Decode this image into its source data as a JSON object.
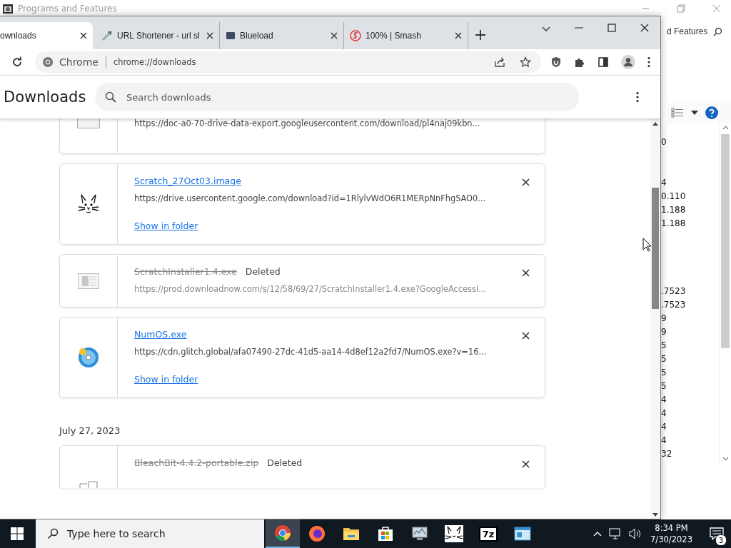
{
  "background_window": {
    "title": "Programs and Features",
    "search": {
      "value": "d Features"
    },
    "version_column": [
      [
        "0"
      ],
      [
        "4",
        "0.110",
        "1.188",
        "1.188"
      ],
      [
        ".7523",
        ".7523",
        "9",
        "9",
        "5",
        "5",
        "5",
        "5",
        "4",
        "4",
        "4",
        "4",
        "32"
      ]
    ]
  },
  "browser": {
    "tabs": [
      {
        "label": "ownloads",
        "selected": true
      },
      {
        "label": "URL Shortener - url sl",
        "selected": false
      },
      {
        "label": "Blueload",
        "selected": false
      },
      {
        "label": "100% | Smash",
        "selected": false
      }
    ],
    "address_bar": {
      "site": "Chrome",
      "url": "chrome://downloads"
    },
    "page_title": "Downloads",
    "search": {
      "placeholder": "Search downloads"
    },
    "downloads": [
      {
        "url": "https://doc-a0-70-drive-data-export.googleusercontent.com/download/pl4naj09kbn...",
        "deleted": false
      },
      {
        "file_name": "Scratch_27Oct03.image",
        "url": "https://drive.usercontent.google.com/download?id=1RlylvWdO6R1MERpNnFhg5AO0...",
        "action": "Show in folder",
        "deleted": false
      },
      {
        "file_name": "ScratchInstaller1.4.exe",
        "status": "Deleted",
        "url": "https://prod.downloadnow.com/s/12/58/69/27/ScratchInstaller1.4.exe?GoogleAccessI...",
        "deleted": true
      },
      {
        "file_name": "NumOS.exe",
        "url": "https://cdn.glitch.global/afa07490-27dc-41d5-aa14-4d8ef12a2fd7/NumOS.exe?v=16...",
        "action": "Show in folder",
        "deleted": false
      }
    ],
    "date_heading": "July 27, 2023",
    "downloads_earlier": [
      {
        "file_name": "BleachBit-4.4.2-portable.zip",
        "status": "Deleted",
        "deleted": true
      }
    ]
  },
  "taskbar": {
    "search_placeholder": "Type here to search",
    "apps": [
      {
        "selected": true
      },
      {
        "selected": false
      },
      {
        "selected": false
      },
      {
        "selected": false
      },
      {
        "selected": false
      },
      {
        "selected": false
      },
      {
        "selected": false,
        "label": "7z"
      },
      {
        "selected": false
      }
    ],
    "time": "8:34 PM",
    "date": "7/30/2023",
    "notifications": "3"
  }
}
